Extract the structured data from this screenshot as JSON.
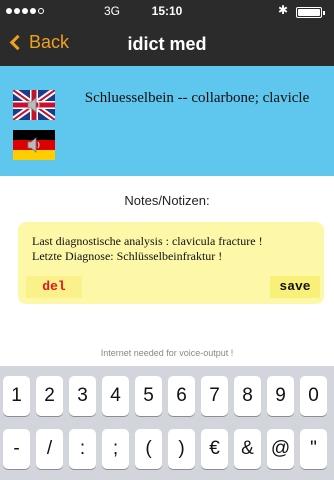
{
  "status_bar": {
    "network": "3G",
    "time": "15:10",
    "signal_icon": "signal-dots-icon",
    "bluetooth_icon": "bluetooth-icon",
    "battery_icon": "battery-icon"
  },
  "nav": {
    "back_label": "Back",
    "title": "idict med",
    "accent_color": "#f0a020"
  },
  "entry": {
    "term": "Schluesselbein -- collarbone; clavicle",
    "languages": [
      "English",
      "German"
    ],
    "panel_color": "#5fc6ee"
  },
  "notes": {
    "heading": "Notes/Notizen:",
    "text": "Last diagnostische analysis : clavicula fracture !\nLetzte Diagnose: Schlüsselbeinfraktur !",
    "del_label": "del",
    "save_label": "save",
    "box_color": "#fcf8a8"
  },
  "footnote": "Internet needed for voice-output !",
  "keyboard": {
    "row1": [
      "1",
      "2",
      "3",
      "4",
      "5",
      "6",
      "7",
      "8",
      "9",
      "0"
    ],
    "row2": [
      "-",
      "/",
      ":",
      ";",
      "(",
      ")",
      "€",
      "&",
      "@",
      "\""
    ]
  }
}
